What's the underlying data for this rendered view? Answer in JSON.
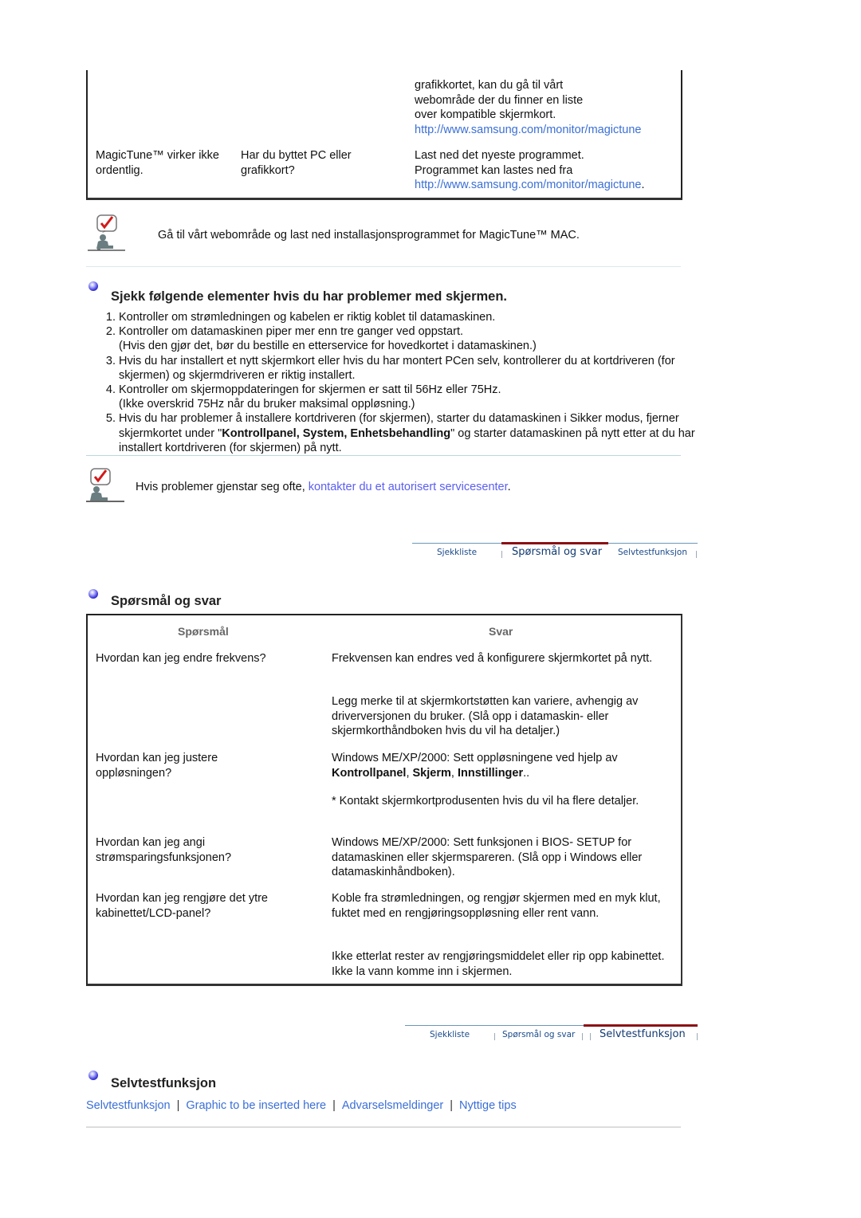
{
  "top_table": {
    "row_continued": {
      "answer_lines": [
        "grafikkortet, kan du gå til vårt",
        "webområde der du finner en liste",
        "over kompatible skjermkort."
      ],
      "link": "http://www.samsung.com/monitor/magictune"
    },
    "row_magictune": {
      "problem": "MagicTune™ virker ikke ordentlig.",
      "check": "Har du byttet PC eller grafikkort?",
      "answer_lines": [
        "Last ned det nyeste programmet.",
        "Programmet kan lastes ned fra"
      ],
      "link": "http://www.samsung.com/monitor/magictune",
      "link_suffix": "."
    }
  },
  "note_mac": {
    "icon": "checklist-note-icon",
    "text": "Gå til vårt webområde og last ned installasjonsprogrammet for MagicTune™ MAC."
  },
  "checklist": {
    "title": "Sjekk følgende elementer hvis du har problemer med skjermen.",
    "items": [
      {
        "lines": [
          "Kontroller om strømledningen og kabelen er riktig koblet til datamaskinen."
        ]
      },
      {
        "lines": [
          "Kontroller om datamaskinen piper mer enn tre ganger ved oppstart.",
          "(Hvis den gjør det, bør du bestille en etterservice for hovedkortet i datamaskinen.)"
        ]
      },
      {
        "lines": [
          "Hvis du har installert et nytt skjermkort eller hvis du har montert PCen selv, kontrollerer du at kortdriveren (for skjermen) og skjermdriveren er riktig installert."
        ]
      },
      {
        "lines": [
          "Kontroller om skjermoppdateringen for skjermen er satt til 56Hz eller 75Hz.",
          "(Ikke overskrid 75Hz når du bruker maksimal oppløsning.)"
        ]
      },
      {
        "before": "Hvis du har problemer å installere kortdriveren (for skjermen), starter du datamaskinen i Sikker modus, fjerner skjermkortet under \"",
        "bold": "Kontrollpanel, System, Enhetsbehandling",
        "after": "\" og starter datamaskinen på nytt etter at du har installert kortdriveren (for skjermen) på nytt."
      }
    ]
  },
  "note_service": {
    "text": "Hvis problemer gjenstar seg ofte, ",
    "link": "kontakter du et autorisert servicesenter",
    "suffix": "."
  },
  "subnav": {
    "items": [
      "Sjekkliste",
      "Spørsmål og svar",
      "Selvtestfunksjon"
    ],
    "accent_color": "#8b0f14"
  },
  "qa": {
    "title": "Spørsmål og svar",
    "headers": {
      "question": "Spørsmål",
      "answer": "Svar"
    },
    "rows": [
      {
        "question": "Hvordan kan jeg endre frekvens?",
        "answer": "Frekvensen kan endres ved å konfigurere skjermkortet på nytt."
      },
      {
        "question": "",
        "answer": "Legg merke til at skjermkortstøtten kan variere, avhengig av driverversjonen du bruker. (Slå opp i datamaskin- eller skjermkorthåndboken hvis du vil ha detaljer.)"
      },
      {
        "question": "Hvordan kan jeg justere oppløsningen?",
        "answer_prefix": "Windows ME/XP/2000: Sett oppløsningene ved hjelp av ",
        "answer_bold": [
          "Kontrollpanel",
          "Skjerm",
          "Innstillinger"
        ],
        "answer_suffix": ".."
      },
      {
        "question": "",
        "answer": "* Kontakt skjermkortprodusenten hvis du vil ha flere detaljer."
      },
      {
        "question": "Hvordan kan jeg angi strømsparingsfunksjonen?",
        "answer": "Windows ME/XP/2000: Sett funksjonen i BIOS- SETUP for datamaskinen eller skjermspareren. (Slå opp i Windows eller datamaskinhåndboken)."
      },
      {
        "question": "Hvordan kan jeg rengjøre det ytre kabinettet/LCD-panel?",
        "answer": "Koble fra strømledningen, og rengjør skjermen med en myk klut, fuktet med en rengjøringsoppløsning eller rent vann."
      },
      {
        "question": "",
        "answer": "Ikke etterlat rester av rengjøringsmiddelet eller rip opp kabinettet. Ikke la vann komme inn i skjermen."
      }
    ]
  },
  "selftest": {
    "title": "Selvtestfunksjon",
    "links": [
      "Selvtestfunksjon",
      "Graphic to be inserted here",
      "Advarselsmeldinger",
      "Nyttige tips"
    ],
    "separator": "|"
  }
}
